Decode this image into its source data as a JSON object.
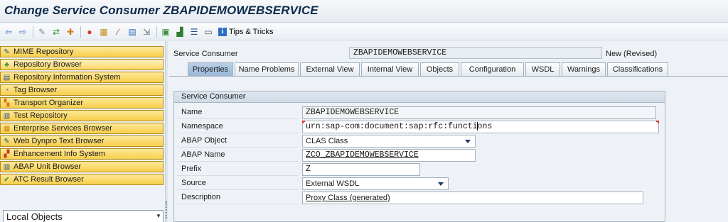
{
  "window": {
    "title": "Change Service Consumer ZBAPIDEMOWEBSERVICE"
  },
  "toolbar": {
    "icons": [
      "back-arrow-icon",
      "forward-arrow-icon",
      "other-object-icon",
      "display-change-icon",
      "activate-icon",
      "where-used-icon",
      "object-list-icon",
      "test-icon",
      "navigation-window-icon",
      "hierarchy-icon",
      "layout-icon",
      "frame-icon",
      "info-icon"
    ],
    "tips_label": "Tips & Tricks"
  },
  "navigation": {
    "items": [
      {
        "label": "MIME Repository",
        "icon": "mime-icon"
      },
      {
        "label": "Repository Browser",
        "icon": "repository-browser-icon"
      },
      {
        "label": "Repository Information System",
        "icon": "repository-info-icon"
      },
      {
        "label": "Tag Browser",
        "icon": "tag-icon"
      },
      {
        "label": "Transport Organizer",
        "icon": "transport-icon"
      },
      {
        "label": "Test Repository",
        "icon": "test-repository-icon"
      },
      {
        "label": "Enterprise Services Browser",
        "icon": "enterprise-services-icon"
      },
      {
        "label": "Web Dynpro Text Browser",
        "icon": "web-dynpro-icon"
      },
      {
        "label": "Enhancement Info System",
        "icon": "enhancement-icon"
      },
      {
        "label": "ABAP Unit Browser",
        "icon": "abap-unit-icon"
      },
      {
        "label": "ATC Result Browser",
        "icon": "atc-icon"
      }
    ],
    "object_selector": "Local Objects"
  },
  "header": {
    "service_consumer_label": "Service Consumer",
    "service_consumer_value": "ZBAPIDEMOWEBSERVICE",
    "status": "New (Revised)"
  },
  "tabs": [
    {
      "label": "Properties",
      "active": true
    },
    {
      "label": "Name Problems"
    },
    {
      "label": "External View"
    },
    {
      "label": "Internal View"
    },
    {
      "label": "Objects"
    },
    {
      "label": "Configuration"
    },
    {
      "label": "WSDL"
    },
    {
      "label": "Warnings"
    },
    {
      "label": "Classifications"
    }
  ],
  "form": {
    "group_title": "Service Consumer",
    "name": {
      "label": "Name",
      "value": "ZBAPIDEMOWEBSERVICE"
    },
    "namespace": {
      "label": "Namespace",
      "value_before_cursor": "urn:sap-com:document:sap:rfc:functi",
      "value_after_cursor": "ons"
    },
    "abap_object": {
      "label": "ABAP Object",
      "value": "CLAS Class"
    },
    "abap_name": {
      "label": "ABAP Name",
      "value": "ZCO_ZBAPIDEMOWEBSERVICE"
    },
    "prefix": {
      "label": "Prefix",
      "value": "Z"
    },
    "source": {
      "label": "Source",
      "value": "External WSDL"
    },
    "description": {
      "label": "Description",
      "value": "Proxy Class (generated)"
    }
  }
}
